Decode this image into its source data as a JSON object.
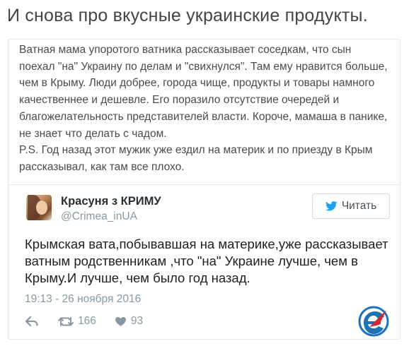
{
  "page": {
    "headline": "И снова про вкусные украинские продукты."
  },
  "post": {
    "lines": [
      "Ватная мама упоротого ватника рассказывает соседкам, что сын",
      "поехал \"на\" Украину по делам и \"свихнулся\". Там ему нравится больше,",
      "чем в Крыму. Люди добрее, города чище, продукты и товары намного",
      "качественнее и дешевле. Его поразило отсутствие очередей и",
      "благожелательность представителей власти. Короче, мамаша в панике,",
      "не знает что делать с чадом.",
      "P.S. Год назад этот мужик уже ездил на материк и по приезду в Крым",
      "рассказывал, как там все плохо."
    ]
  },
  "tweet": {
    "display_name": "Красуня з КРИМУ",
    "screen_name": "@Crimea_inUA",
    "follow_label": "Читать",
    "text_lines": [
      "Крымская вата,побывавшая на материке,уже рассказывает",
      "ватным родственникам ,что \"на\" Украине лучше, чем в",
      "Крыму.И лучше, чем было год назад."
    ],
    "timestamp": "19:13 - 26 ноября 2016",
    "retweet_count": "166",
    "like_count": "93"
  },
  "colors": {
    "twitter_blue": "#1da1f2",
    "muted": "#8899a6",
    "border": "#e1e8ed",
    "logo_red": "#d7262c",
    "logo_blue": "#1e73b8"
  },
  "icons": [
    "reply-icon",
    "retweet-icon",
    "heart-icon",
    "twitter-bird-icon",
    "site-logo"
  ]
}
